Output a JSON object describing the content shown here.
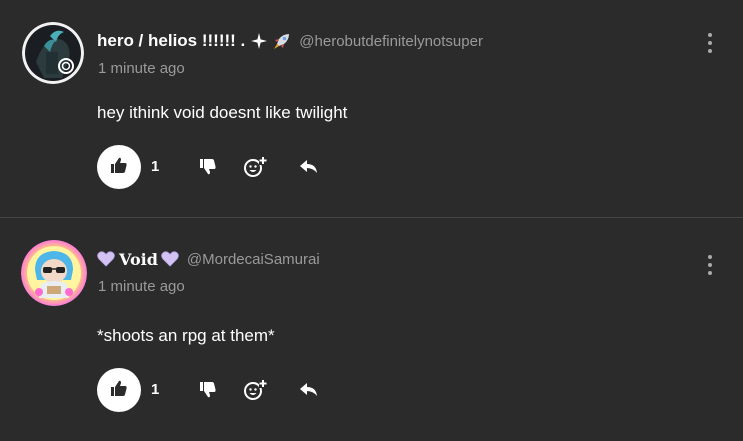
{
  "comments": [
    {
      "display_name": "hero / helios !!!!!! .",
      "username": "@herobutdefinitelynotsuper",
      "timestamp": "1 minute ago",
      "text": "hey ithink void doesnt like twilight",
      "like_count": "1",
      "name_decorations": [
        "sparkle-icon",
        "rocket-icon"
      ],
      "avatar": "dark-character-avatar"
    },
    {
      "display_name": "Void",
      "username": "@MordecaiSamurai",
      "timestamp": "1 minute ago",
      "text": "*shoots an rpg at them*",
      "like_count": "1",
      "name_decorations": [
        "purple-heart-icon",
        "purple-heart-icon"
      ],
      "avatar": "blue-haired-character-avatar"
    }
  ],
  "colors": {
    "background": "#2b2b2b",
    "secondary_text": "#9a9a9a",
    "divider": "#454545",
    "heart": "#d4c2f5"
  }
}
